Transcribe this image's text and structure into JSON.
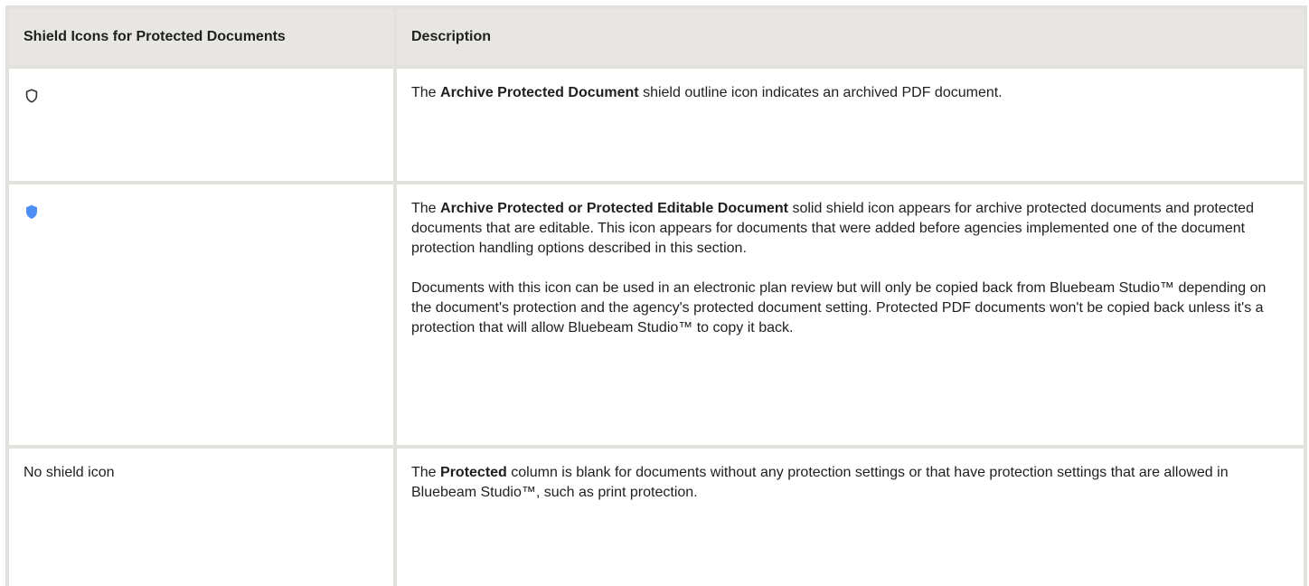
{
  "table": {
    "headers": [
      "Shield Icons for Protected Documents",
      "Description"
    ],
    "rows": [
      {
        "icon": "shield-outline-icon",
        "col1_text": "",
        "desc": [
          {
            "pre": "The ",
            "bold": "Archive Protected Document",
            "post": " shield outline icon indicates an archived PDF document."
          }
        ]
      },
      {
        "icon": "shield-solid-icon",
        "col1_text": "",
        "desc": [
          {
            "pre": "The ",
            "bold": "Archive Protected or Protected Editable Document",
            "post": " solid shield icon appears for archive protected documents and protected documents that are editable. This icon appears for documents that were added before agencies implemented one of the document protection handling options described in this section."
          },
          {
            "pre": "Documents with this icon can be used in an electronic plan review but will only be copied back from Bluebeam Studio™ depending on the document's protection and the agency's protected document setting. Protected PDF documents won't be copied back unless it's a protection that will allow Bluebeam Studio™ to copy it back.",
            "bold": "",
            "post": ""
          }
        ]
      },
      {
        "icon": "",
        "col1_text": "No shield icon",
        "desc": [
          {
            "pre": "The ",
            "bold": "Protected",
            "post": " column is blank for documents without any protection settings or that have protection settings that are allowed in Bluebeam Studio™, such as print protection."
          }
        ]
      }
    ]
  },
  "colors": {
    "shield_solid": "#4f8ef5",
    "shield_outline": "#333333",
    "header_bg": "#e8e6e2",
    "border": "#e3e1dd"
  }
}
